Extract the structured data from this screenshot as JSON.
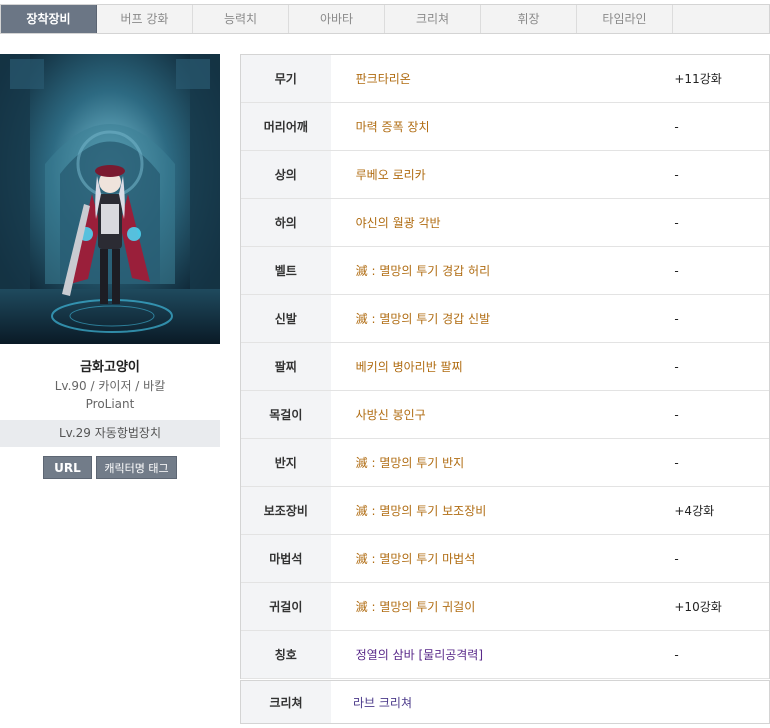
{
  "tabs": [
    {
      "label": "장착장비",
      "active": true
    },
    {
      "label": "버프 강화",
      "active": false
    },
    {
      "label": "능력치",
      "active": false
    },
    {
      "label": "아바타",
      "active": false
    },
    {
      "label": "크리쳐",
      "active": false
    },
    {
      "label": "휘장",
      "active": false
    },
    {
      "label": "타임라인",
      "active": false
    }
  ],
  "character": {
    "name": "금화고양이",
    "info": "Lv.90 / 카이저 / 바칼",
    "guild": "ProLiant",
    "level_text": "Lv.29 자동항법장치",
    "url_button": "URL",
    "tag_button": "캐릭터명 태그"
  },
  "equipment": [
    {
      "slot": "무기",
      "item": "판크타리온",
      "enhance": "+11강화"
    },
    {
      "slot": "머리어깨",
      "item": "마력 증폭 장치",
      "enhance": "-"
    },
    {
      "slot": "상의",
      "item": "루베오 로리카",
      "enhance": "-"
    },
    {
      "slot": "하의",
      "item": "야신의 월광 각반",
      "enhance": "-"
    },
    {
      "slot": "벨트",
      "item": "滅 : 멸망의 투기 경갑 허리",
      "enhance": "-"
    },
    {
      "slot": "신발",
      "item": "滅 : 멸망의 투기 경갑 신발",
      "enhance": "-"
    },
    {
      "slot": "팔찌",
      "item": "베키의 병아리반 팔찌",
      "enhance": "-"
    },
    {
      "slot": "목걸이",
      "item": "사방신 봉인구",
      "enhance": "-"
    },
    {
      "slot": "반지",
      "item": "滅 : 멸망의 투기 반지",
      "enhance": "-"
    },
    {
      "slot": "보조장비",
      "item": "滅 : 멸망의 투기 보조장비",
      "enhance": "+4강화"
    },
    {
      "slot": "마법석",
      "item": "滅 : 멸망의 투기 마법석",
      "enhance": "-"
    },
    {
      "slot": "귀걸이",
      "item": "滅 : 멸망의 투기 귀걸이",
      "enhance": "+10강화"
    },
    {
      "slot": "칭호",
      "item": "정열의 삼바 [물리공격력]",
      "enhance": "-"
    }
  ],
  "creature": {
    "slot": "크리쳐",
    "item": "라브 크리쳐"
  },
  "colors": {
    "tab_active": "#6b7685",
    "item_name": "#b06c12",
    "title_item": "#5a2a8a",
    "slot_bg": "#f3f4f6"
  }
}
